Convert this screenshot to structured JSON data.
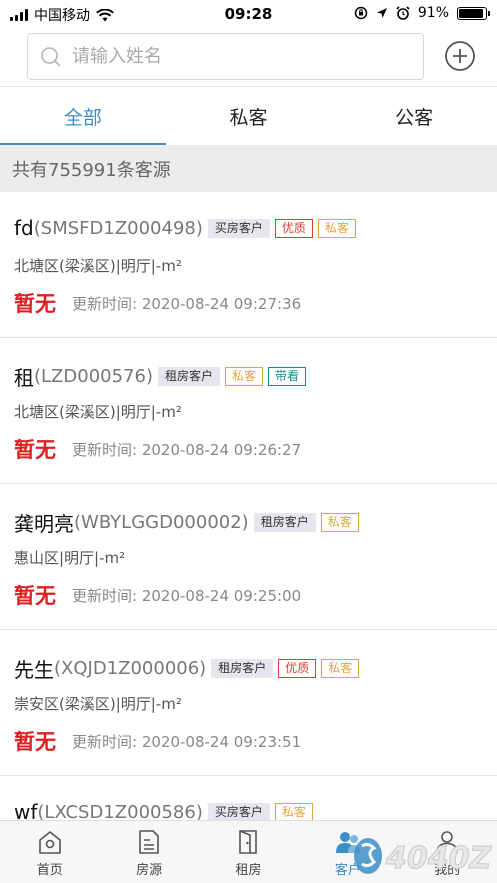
{
  "status_bar": {
    "carrier": "中国移动",
    "time": "09:28",
    "battery": "91%",
    "battery_level": 0.91
  },
  "search": {
    "placeholder": "请输入姓名"
  },
  "tabs": [
    {
      "label": "全部",
      "active": true
    },
    {
      "label": "私客",
      "active": false
    },
    {
      "label": "公客",
      "active": false
    }
  ],
  "count_text": "共有755991条客源",
  "customers": [
    {
      "name": "fd",
      "code": "(SMSFD1Z000498)",
      "tags": [
        {
          "label": "买房客户",
          "kind": "type"
        },
        {
          "label": "优质",
          "kind": "quality"
        },
        {
          "label": "私客",
          "kind": "private"
        }
      ],
      "location": "北塘区(梁溪区)|明厅|-m²",
      "price": "暂无",
      "update": "更新时间:  2020-08-24 09:27:36"
    },
    {
      "name": "租",
      "code": "(LZD000576)",
      "tags": [
        {
          "label": "租房客户",
          "kind": "type"
        },
        {
          "label": "私客",
          "kind": "private"
        },
        {
          "label": "带看",
          "kind": "viewing"
        }
      ],
      "location": "北塘区(梁溪区)|明厅|-m²",
      "price": "暂无",
      "update": "更新时间:  2020-08-24 09:26:27"
    },
    {
      "name": "龚明亮",
      "code": "(WBYLGGD000002)",
      "tags": [
        {
          "label": "租房客户",
          "kind": "type"
        },
        {
          "label": "私客",
          "kind": "private"
        }
      ],
      "location": "惠山区|明厅|-m²",
      "price": "暂无",
      "update": "更新时间:  2020-08-24 09:25:00"
    },
    {
      "name": "先生",
      "code": "(XQJD1Z000006)",
      "tags": [
        {
          "label": "租房客户",
          "kind": "type"
        },
        {
          "label": "优质",
          "kind": "quality"
        },
        {
          "label": "私客",
          "kind": "private"
        }
      ],
      "location": "崇安区(梁溪区)|明厅|-m²",
      "price": "暂无",
      "update": "更新时间:  2020-08-24 09:23:51"
    },
    {
      "name": "wf",
      "code": "(LXCSD1Z000586)",
      "tags": [
        {
          "label": "买房客户",
          "kind": "type"
        },
        {
          "label": "私客",
          "kind": "private"
        }
      ],
      "location": "",
      "price": "",
      "update": ""
    }
  ],
  "bottom_nav": [
    {
      "label": "首页",
      "icon": "home-icon",
      "active": false
    },
    {
      "label": "房源",
      "icon": "listing-icon",
      "active": false
    },
    {
      "label": "租房",
      "icon": "door-icon",
      "active": false
    },
    {
      "label": "客户",
      "icon": "customer-icon",
      "active": true
    },
    {
      "label": "我的",
      "icon": "profile-icon",
      "active": false
    }
  ],
  "watermark_text": "4040Z",
  "colors": {
    "accent": "#3c8fc6",
    "price": "#e02020",
    "tag_quality": "#e23a3a",
    "tag_private": "#e4a53a",
    "tag_viewing": "#1e8a8a"
  }
}
